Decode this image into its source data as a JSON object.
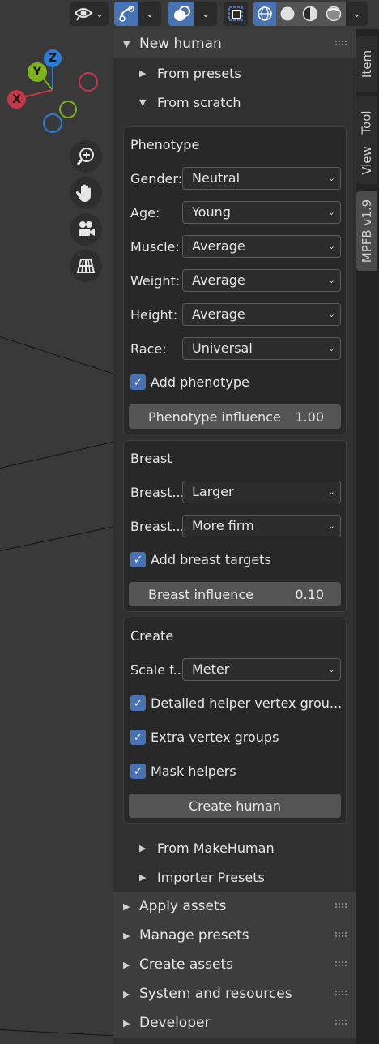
{
  "header": {
    "icons": [
      "eye-visibility-icon",
      "gizmo-curve-icon",
      "overlay-icon",
      "xray-icon",
      "wireframe-shading-icon",
      "solid-shading-icon",
      "material-shading-icon",
      "rendered-shading-icon"
    ]
  },
  "gizmo": {
    "x": "X",
    "y": "Y",
    "z": "Z"
  },
  "tabs": {
    "item": "Item",
    "tool": "Tool",
    "view": "View",
    "mpfb": "MPFB v1.9"
  },
  "panels": {
    "new_human": "New human",
    "from_presets": "From presets",
    "from_scratch": "From scratch",
    "from_makehuman": "From MakeHuman",
    "importer_presets": "Importer Presets",
    "apply_assets": "Apply assets",
    "manage_presets": "Manage presets",
    "create_assets": "Create assets",
    "system_resources": "System and resources",
    "developer": "Developer"
  },
  "phenotype": {
    "title": "Phenotype",
    "gender_label": "Gender:",
    "gender_value": "Neutral",
    "age_label": "Age:",
    "age_value": "Young",
    "muscle_label": "Muscle:",
    "muscle_value": "Average",
    "weight_label": "Weight:",
    "weight_value": "Average",
    "height_label": "Height:",
    "height_value": "Average",
    "race_label": "Race:",
    "race_value": "Universal",
    "add_phenotype": "Add phenotype",
    "influence_label": "Phenotype influence",
    "influence_value": "1.00"
  },
  "breast": {
    "title": "Breast",
    "size_label": "Breast...",
    "size_value": "Larger",
    "firm_label": "Breast...",
    "firm_value": "More firm",
    "add_targets": "Add breast targets",
    "influence_label": "Breast influence",
    "influence_value": "0.10"
  },
  "create": {
    "title": "Create",
    "scale_label": "Scale f...",
    "scale_value": "Meter",
    "detailed_helper": "Detailed helper vertex grou...",
    "extra_groups": "Extra vertex groups",
    "mask_helpers": "Mask helpers",
    "create_button": "Create human"
  },
  "colors": {
    "accent": "#4772b3",
    "x_axis": "#c8364a",
    "y_axis": "#7fb31a",
    "z_axis": "#2e7cd6"
  }
}
